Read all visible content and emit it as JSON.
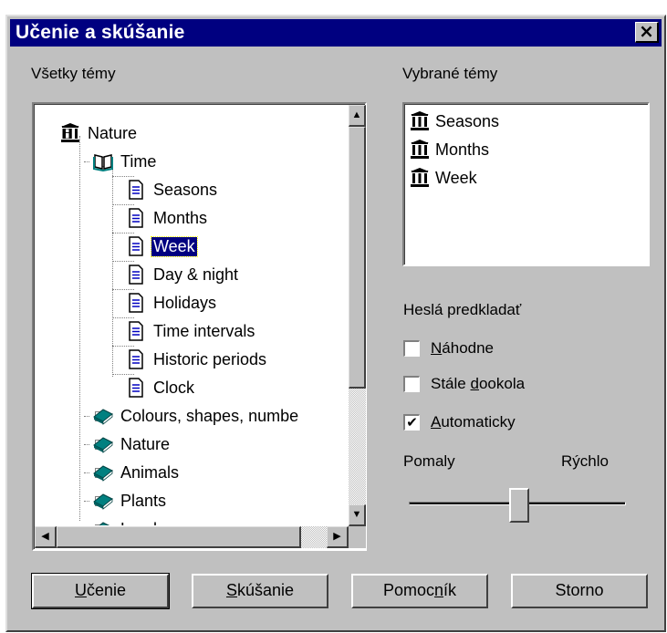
{
  "window": {
    "title": "Učenie a skúšanie",
    "close_label": "×"
  },
  "left_panel": {
    "label": "Všetky témy",
    "tree": [
      {
        "label": "Nature",
        "icon": "temple-icon",
        "level": 0,
        "expander": "minus"
      },
      {
        "label": "Time",
        "icon": "open-book-icon",
        "level": 1,
        "expander": "minus"
      },
      {
        "label": "Seasons",
        "icon": "document-icon",
        "level": 2
      },
      {
        "label": "Months",
        "icon": "document-icon",
        "level": 2
      },
      {
        "label": "Week",
        "icon": "document-icon",
        "level": 2,
        "selected": true
      },
      {
        "label": "Day & night",
        "icon": "document-icon",
        "level": 2
      },
      {
        "label": "Holidays",
        "icon": "document-icon",
        "level": 2
      },
      {
        "label": "Time intervals",
        "icon": "document-icon",
        "level": 2
      },
      {
        "label": "Historic periods",
        "icon": "document-icon",
        "level": 2
      },
      {
        "label": "Clock",
        "icon": "document-icon",
        "level": 2
      },
      {
        "label": "Colours, shapes, numbe",
        "icon": "closed-book-icon",
        "level": 1,
        "expander": "plus"
      },
      {
        "label": "Nature",
        "icon": "closed-book-icon",
        "level": 1,
        "expander": "plus"
      },
      {
        "label": "Animals",
        "icon": "closed-book-icon",
        "level": 1,
        "expander": "plus"
      },
      {
        "label": "Plants",
        "icon": "closed-book-icon",
        "level": 1,
        "expander": "plus"
      },
      {
        "label": "Land",
        "icon": "closed-book-icon",
        "level": 1,
        "expander": "plus"
      }
    ]
  },
  "right_panel": {
    "label": "Vybrané témy",
    "items": [
      "Seasons",
      "Months",
      "Week"
    ],
    "item_icon": "temple-icon"
  },
  "options": {
    "group_label": "Heslá predkladať",
    "random": {
      "prefix": "",
      "accel": "N",
      "rest": "áhodne",
      "checked": false
    },
    "loop": {
      "prefix": "Stále ",
      "accel": "d",
      "rest": "ookola",
      "checked": false
    },
    "auto": {
      "prefix": "",
      "accel": "A",
      "rest": "utomaticky",
      "checked": true
    },
    "slow_label": "Pomaly",
    "fast_label": "Rýchlo",
    "speed_level": 0.51
  },
  "buttons": {
    "learn": {
      "accel": "U",
      "rest": "čenie"
    },
    "test": {
      "accel": "S",
      "rest": "kúšanie"
    },
    "helper": {
      "prefix": "Pomoc",
      "accel": "n",
      "rest": "ík"
    },
    "cancel": "Storno"
  },
  "scroll": {
    "up": "▲",
    "down": "▼",
    "left": "◀",
    "right": "▶"
  },
  "check_mark": "✔",
  "colors": {
    "title_bg": "#000080",
    "face": "#c0c0c0",
    "selection": "#000080",
    "icon_teal": "#008080",
    "icon_blue": "#0000c0"
  }
}
